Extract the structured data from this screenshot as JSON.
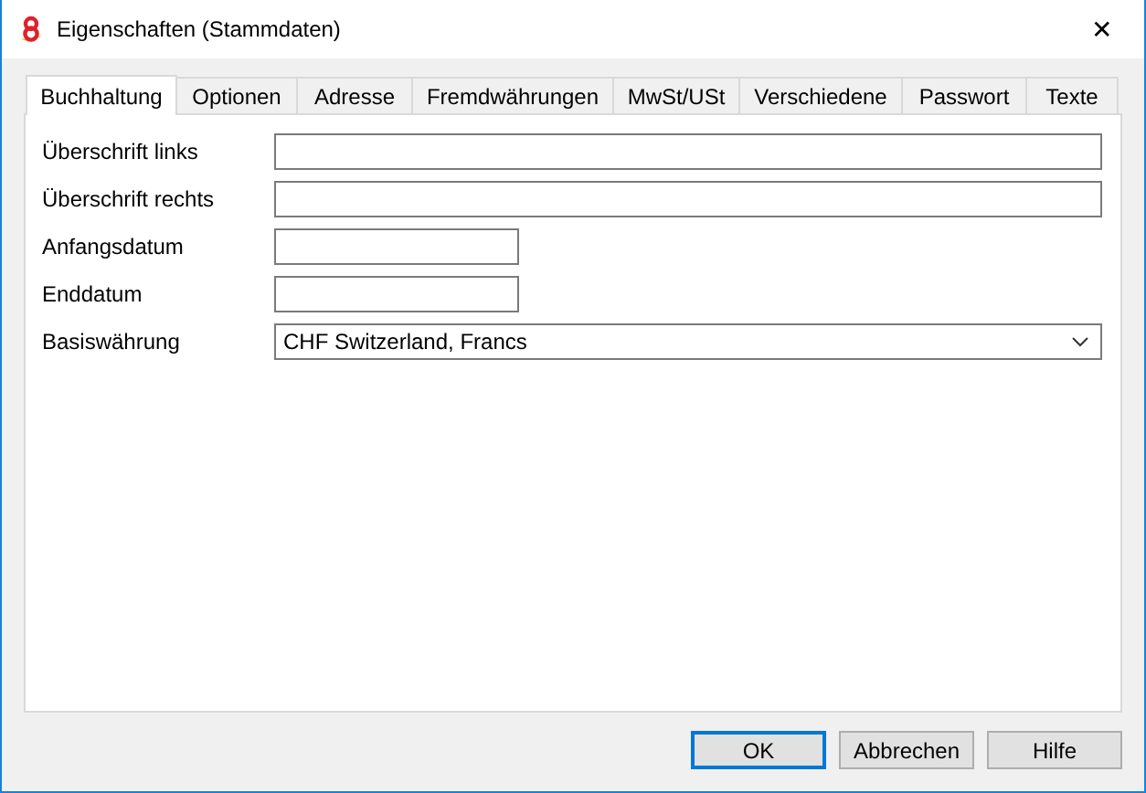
{
  "window": {
    "title": "Eigenschaften (Stammdaten)",
    "close": "✕"
  },
  "tabs": [
    {
      "label": "Buchhaltung",
      "selected": true
    },
    {
      "label": "Optionen",
      "selected": false
    },
    {
      "label": "Adresse",
      "selected": false
    },
    {
      "label": "Fremdwährungen",
      "selected": false
    },
    {
      "label": "MwSt/USt",
      "selected": false
    },
    {
      "label": "Verschiedene",
      "selected": false
    },
    {
      "label": "Passwort",
      "selected": false
    },
    {
      "label": "Texte",
      "selected": false
    }
  ],
  "fields": [
    {
      "label": "Überschrift links",
      "kind": "wide"
    },
    {
      "label": "Überschrift rechts",
      "kind": "wide"
    },
    {
      "label": "Anfangsdatum",
      "kind": "short"
    },
    {
      "label": "Enddatum",
      "kind": "short"
    },
    {
      "label": "Basiswährung",
      "kind": "dropdown",
      "value": "CHF Switzerland, Francs"
    }
  ],
  "buttons": [
    {
      "label": "OK",
      "default": true
    },
    {
      "label": "Abbrechen",
      "default": false
    },
    {
      "label": "Hilfe",
      "default": false
    }
  ]
}
